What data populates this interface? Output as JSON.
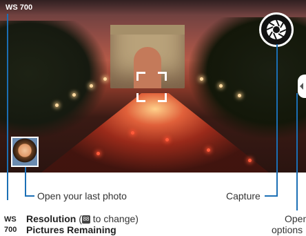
{
  "viewfinder": {
    "resolution_badge": "WS 700"
  },
  "callouts": {
    "last_photo": "Open your last photo",
    "capture": "Capture",
    "options_line1": "Open",
    "options_line2": "options"
  },
  "legend": {
    "resolution_code_line1": "WS",
    "resolution_code_line2": "700",
    "resolution_title": "Resolution",
    "resolution_paren_open": " (",
    "resolution_icon": "88",
    "resolution_hint": " to change)",
    "pictures_remaining_title": "Pictures Remaining"
  },
  "colors": {
    "accent": "#1b6fb5",
    "button_bg": "#111111"
  },
  "icons": {
    "capture": "aperture-icon",
    "options": "chevron-left-icon",
    "resolution": "resolution-icon"
  }
}
